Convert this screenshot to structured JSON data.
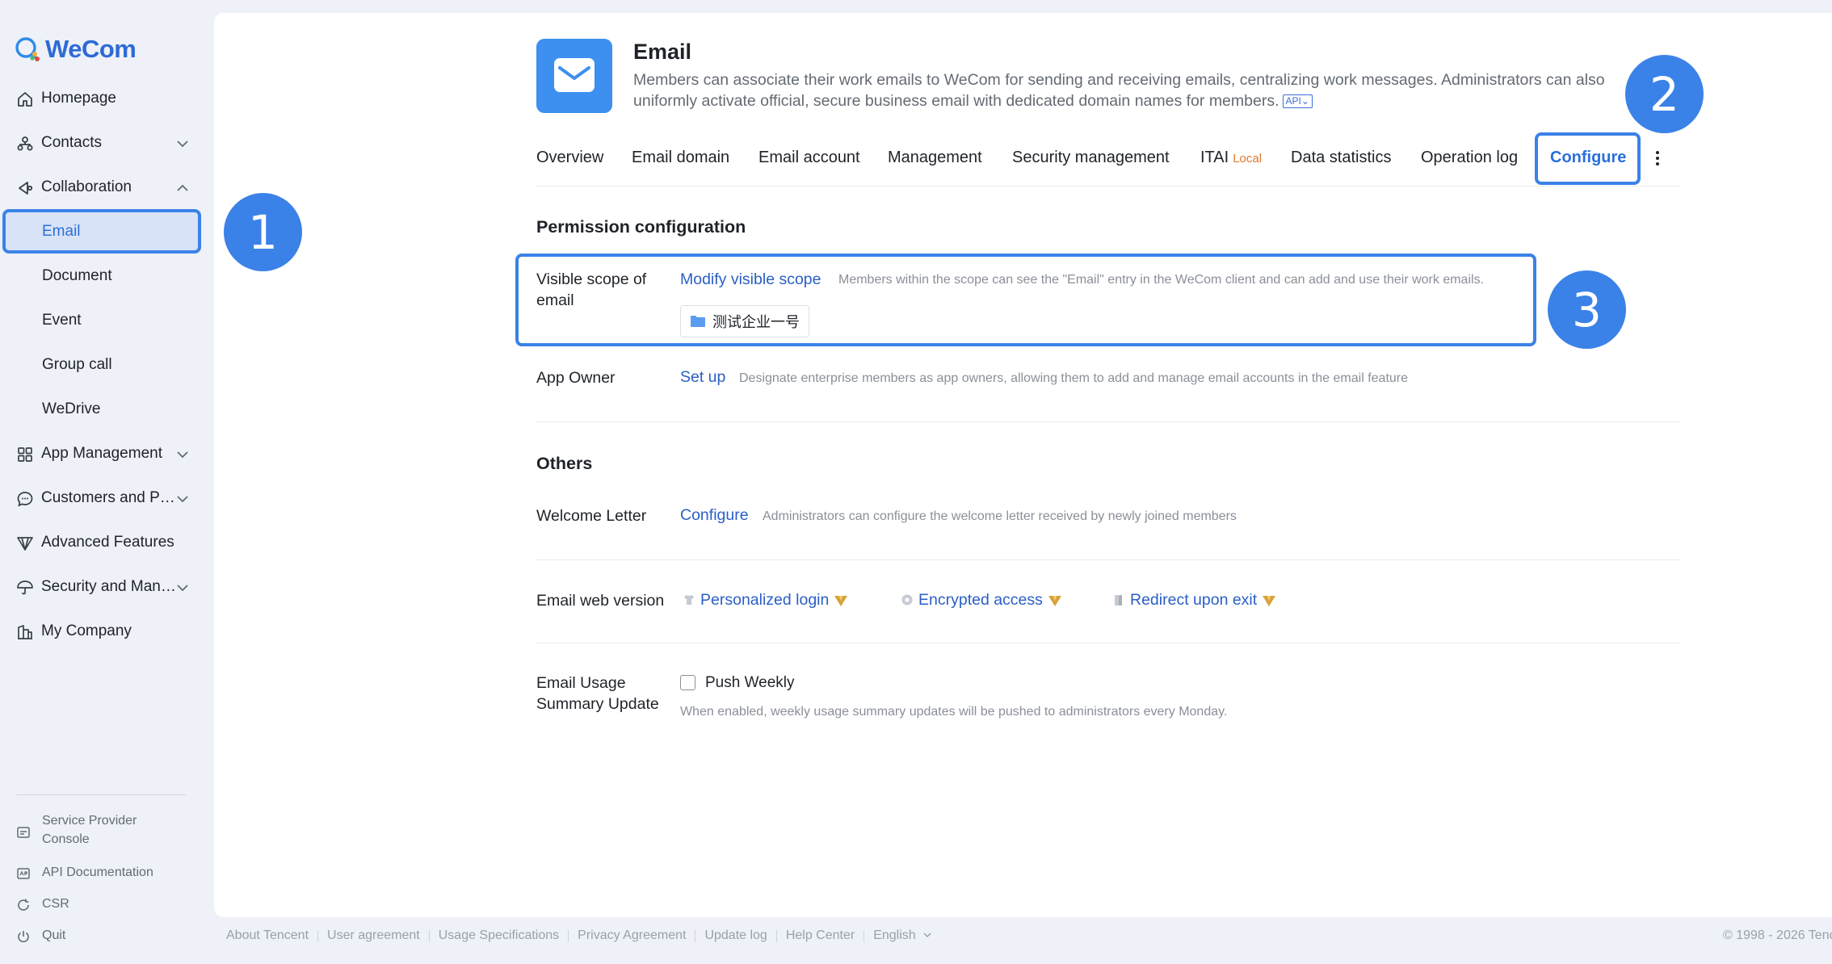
{
  "brand": {
    "name": "WeCom"
  },
  "sidebar": {
    "items": [
      {
        "label": "Homepage",
        "icon": "home-icon"
      },
      {
        "label": "Contacts",
        "icon": "org-chart-icon"
      },
      {
        "label": "Collaboration",
        "icon": "collaboration-icon"
      },
      {
        "label": "Email"
      },
      {
        "label": "Document"
      },
      {
        "label": "Event"
      },
      {
        "label": "Group call"
      },
      {
        "label": "WeDrive"
      },
      {
        "label": "App Management",
        "icon": "grid-icon"
      },
      {
        "label": "Customers and P…",
        "icon": "chat-bubble-icon"
      },
      {
        "label": "Advanced Features",
        "icon": "diamond-icon"
      },
      {
        "label": "Security and Man…",
        "icon": "umbrella-icon"
      },
      {
        "label": "My Company",
        "icon": "buildings-icon"
      }
    ],
    "footer": [
      {
        "label": "Service Provider Console",
        "icon": "console-icon"
      },
      {
        "label": "API Documentation",
        "icon": "api-doc-icon"
      },
      {
        "label": "CSR",
        "icon": "refresh-icon"
      },
      {
        "label": "Quit",
        "icon": "power-icon"
      }
    ]
  },
  "app": {
    "title": "Email",
    "description": "Members can associate their work emails to WeCom for sending and receiving emails, centralizing work messages. Administrators can also uniformly activate official, secure business email with dedicated domain names for members.",
    "api_tag": "API"
  },
  "tabs": [
    {
      "label": "Overview"
    },
    {
      "label": "Email domain"
    },
    {
      "label": "Email account"
    },
    {
      "label": "Management"
    },
    {
      "label": "Security management"
    },
    {
      "label": "ITAI",
      "tag": "Local"
    },
    {
      "label": "Data statistics"
    },
    {
      "label": "Operation log"
    },
    {
      "label": "Configure",
      "active": true
    }
  ],
  "permission": {
    "title": "Permission configuration",
    "scope_label": "Visible scope of email",
    "scope_link": "Modify visible scope",
    "scope_hint": "Members within the scope can see the \"Email\" entry in the WeCom client and can add and use their work emails.",
    "scope_dept": "测试企业一号",
    "owner_label": "App Owner",
    "owner_link": "Set up",
    "owner_hint": "Designate enterprise members as app owners, allowing them to add and manage email accounts in the email feature"
  },
  "others": {
    "title": "Others",
    "welcome_label": "Welcome Letter",
    "welcome_link": "Configure",
    "welcome_hint": "Administrators can configure the welcome letter received by newly joined members",
    "web_label": "Email web version",
    "web_features": [
      "Personalized login",
      "Encrypted access",
      "Redirect upon exit"
    ],
    "summary_label": "Email Usage Summary Update",
    "summary_checkbox": "Push Weekly",
    "summary_checked": false,
    "summary_hint": "When enabled, weekly usage summary updates will be pushed to administrators every Monday."
  },
  "callouts": [
    "1",
    "2",
    "3"
  ],
  "footer": {
    "links": [
      "About Tencent",
      "User agreement",
      "Usage Specifications",
      "Privacy Agreement",
      "Update log",
      "Help Center",
      "English"
    ],
    "copyright": "© 1998 - 2026 Tenc"
  },
  "colors": {
    "accent": "#3b82e8",
    "link": "#2a5fc4",
    "local_tag": "#e0782c",
    "vip": "#d9a13a"
  }
}
